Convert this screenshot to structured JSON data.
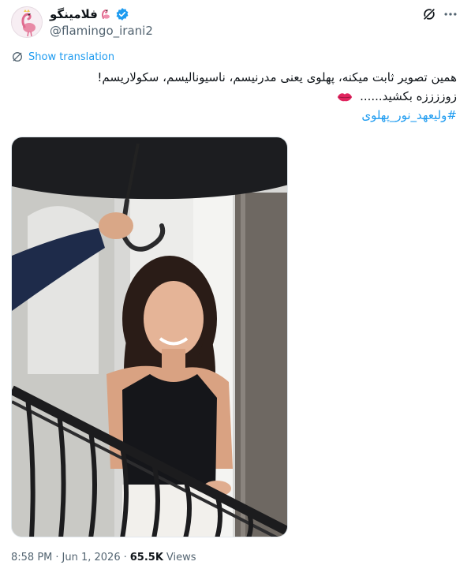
{
  "tweet": {
    "display_name": "فلامینگو",
    "handle": "@flamingo_irani2",
    "show_translation": "Show translation",
    "text_line1": "همین تصویر ثابت میکنه، پهلوی یعنی مدرنیسم، ناسیونالیسم، سکولاریسم!",
    "text_line2": "زوززززه بکشید......",
    "hashtag": "#ولیعهد_نور_پهلوی",
    "time": "8:58 PM",
    "separator": "·",
    "date": "Jun 1, 2026",
    "separator2": "·",
    "views_count": "65.5K",
    "views_label": "Views"
  },
  "icons": {
    "verified": "verified-badge-icon",
    "grok": "grok-icon",
    "more": "more-options-icon",
    "translate": "translate-icon",
    "kiss": "kiss-lips-emoji"
  },
  "colors": {
    "accent": "#1d9bf0",
    "text": "#0f1419",
    "muted": "#536471"
  }
}
